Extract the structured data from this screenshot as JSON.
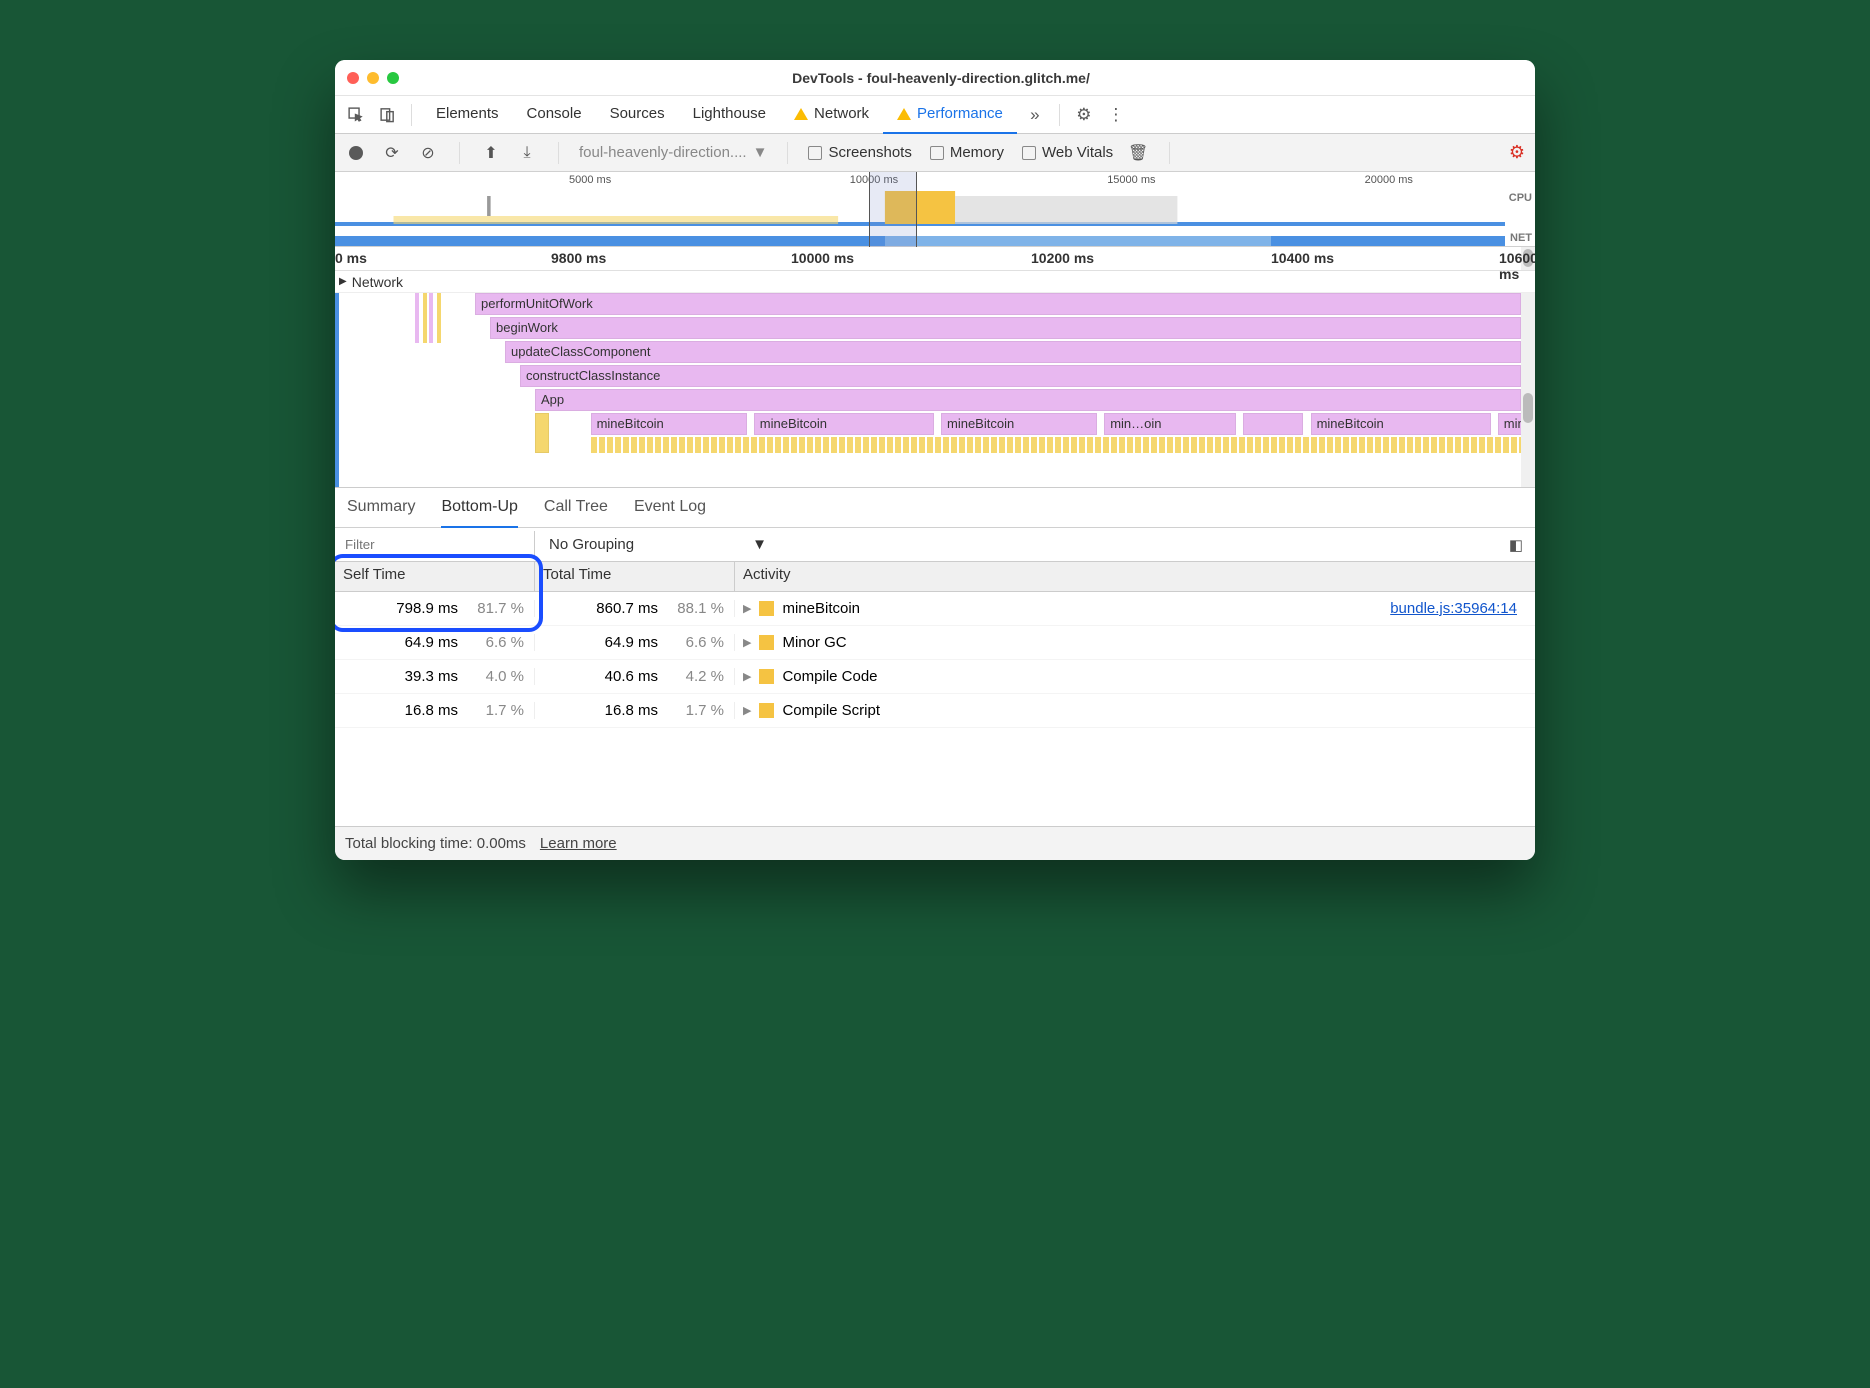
{
  "window": {
    "title": "DevTools - foul-heavenly-direction.glitch.me/"
  },
  "tabs": {
    "items": [
      "Elements",
      "Console",
      "Sources",
      "Lighthouse",
      "Network",
      "Performance"
    ],
    "active": "Performance",
    "warn_tabs": [
      "Network",
      "Performance"
    ]
  },
  "toolbar": {
    "dropdown": "foul-heavenly-direction....",
    "checkboxes": [
      "Screenshots",
      "Memory",
      "Web Vitals"
    ]
  },
  "overview": {
    "ticks": [
      "5000 ms",
      "10000 ms",
      "15000 ms",
      "20000 ms"
    ],
    "labels": {
      "cpu": "CPU",
      "net": "NET"
    },
    "selection_start_pct": 44.5,
    "selection_end_pct": 48.5
  },
  "ruler": {
    "ticks": [
      {
        "label": "0 ms",
        "pos": 0
      },
      {
        "label": "9800 ms",
        "pos": 18
      },
      {
        "label": "10000 ms",
        "pos": 38
      },
      {
        "label": "10200 ms",
        "pos": 58
      },
      {
        "label": "10400 ms",
        "pos": 78
      },
      {
        "label": "10600 ms",
        "pos": 97
      }
    ]
  },
  "network_row": "Network",
  "flame": {
    "stack": [
      "performUnitOfWork",
      "beginWork",
      "updateClassComponent",
      "constructClassInstance",
      "App"
    ],
    "mine_labels": [
      "mineBitcoin",
      "mineBitcoin",
      "mineBitcoin",
      "min…oin",
      "",
      "mineBitcoin",
      "mine…oin"
    ]
  },
  "subtabs": {
    "items": [
      "Summary",
      "Bottom-Up",
      "Call Tree",
      "Event Log"
    ],
    "active": "Bottom-Up"
  },
  "filter": {
    "placeholder": "Filter",
    "grouping": "No Grouping"
  },
  "columns": {
    "self": "Self Time",
    "total": "Total Time",
    "activity": "Activity"
  },
  "rows": [
    {
      "self_ms": "798.9 ms",
      "self_pct": "81.7 %",
      "self_bar": 95,
      "total_ms": "860.7 ms",
      "total_pct": "88.1 %",
      "total_bar": 99,
      "activity": "mineBitcoin",
      "link": "bundle.js:35964:14"
    },
    {
      "self_ms": "64.9 ms",
      "self_pct": "6.6 %",
      "self_bar": 8,
      "total_ms": "64.9 ms",
      "total_pct": "6.6 %",
      "total_bar": 8,
      "activity": "Minor GC",
      "link": ""
    },
    {
      "self_ms": "39.3 ms",
      "self_pct": "4.0 %",
      "self_bar": 5,
      "total_ms": "40.6 ms",
      "total_pct": "4.2 %",
      "total_bar": 5,
      "activity": "Compile Code",
      "link": ""
    },
    {
      "self_ms": "16.8 ms",
      "self_pct": "1.7 %",
      "self_bar": 2,
      "total_ms": "16.8 ms",
      "total_pct": "1.7 %",
      "total_bar": 2,
      "activity": "Compile Script",
      "link": ""
    }
  ],
  "footer": {
    "blocking": "Total blocking time: 0.00ms",
    "learn": "Learn more"
  }
}
